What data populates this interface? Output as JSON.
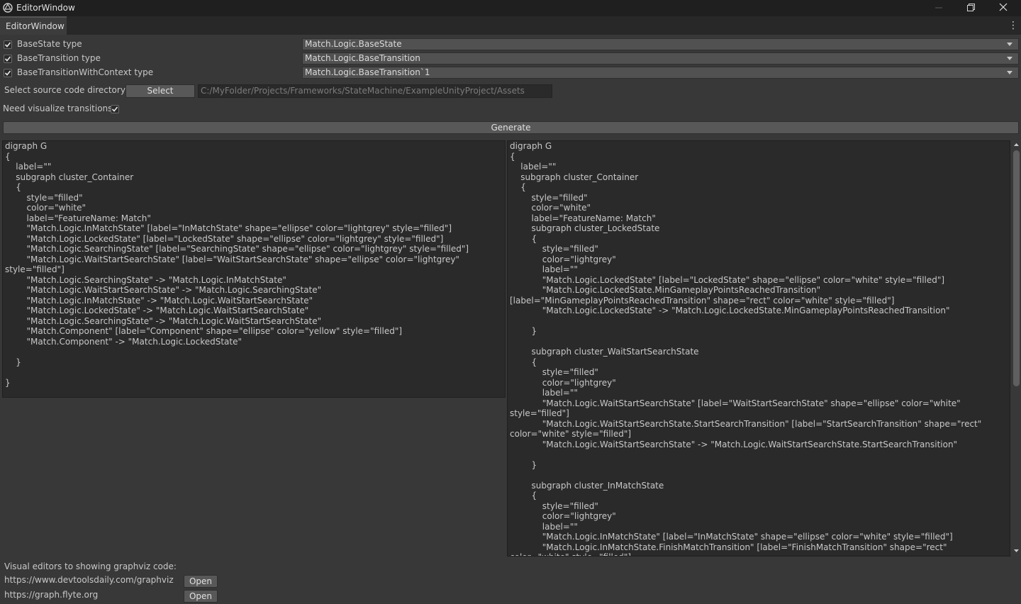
{
  "window": {
    "title": "EditorWindow",
    "minimize_icon": "minimize-icon",
    "maximize_icon": "restore-icon",
    "close_icon": "close-icon"
  },
  "tab": {
    "label": "EditorWindow",
    "menu_icon": "kebab-menu-icon"
  },
  "type_rows": [
    {
      "label": "BaseState type",
      "checked": true,
      "value": "Match.Logic.BaseState"
    },
    {
      "label": "BaseTransition type",
      "checked": true,
      "value": "Match.Logic.BaseTransition"
    },
    {
      "label": "BaseTransitionWithContext type",
      "checked": true,
      "value": "Match.Logic.BaseTransition`1"
    }
  ],
  "source": {
    "label": "Select source code directory",
    "button_label": "Select",
    "path": "C:/MyFolder/Projects/Frameworks/StateMachine/ExampleUnityProject/Assets"
  },
  "visualize": {
    "label": "Need visualize transitions",
    "checked": true
  },
  "generate_label": "Generate",
  "left_code": "digraph G\n{\n\tlabel=\"\"\n\tsubgraph cluster_Container\n\t{\n\t\tstyle=\"filled\"\n\t\tcolor=\"white\"\n\t\tlabel=\"FeatureName: Match\"\n\t\t\"Match.Logic.InMatchState\" [label=\"InMatchState\" shape=\"ellipse\" color=\"lightgrey\" style=\"filled\"]\n\t\t\"Match.Logic.LockedState\" [label=\"LockedState\" shape=\"ellipse\" color=\"lightgrey\" style=\"filled\"]\n\t\t\"Match.Logic.SearchingState\" [label=\"SearchingState\" shape=\"ellipse\" color=\"lightgrey\" style=\"filled\"]\n\t\t\"Match.Logic.WaitStartSearchState\" [label=\"WaitStartSearchState\" shape=\"ellipse\" color=\"lightgrey\"\nstyle=\"filled\"]\n\t\t\"Match.Logic.SearchingState\" -> \"Match.Logic.InMatchState\"\n\t\t\"Match.Logic.WaitStartSearchState\" -> \"Match.Logic.SearchingState\"\n\t\t\"Match.Logic.InMatchState\" -> \"Match.Logic.WaitStartSearchState\"\n\t\t\"Match.Logic.LockedState\" -> \"Match.Logic.WaitStartSearchState\"\n\t\t\"Match.Logic.SearchingState\" -> \"Match.Logic.WaitStartSearchState\"\n\t\t\"Match.Component\" [label=\"Component\" shape=\"ellipse\" color=\"yellow\" style=\"filled\"]\n\t\t\"Match.Component\" -> \"Match.Logic.LockedState\"\n\n\t}\n\n}",
  "right_code": "digraph G\n{\n\tlabel=\"\"\n\tsubgraph cluster_Container\n\t{\n\t\tstyle=\"filled\"\n\t\tcolor=\"white\"\n\t\tlabel=\"FeatureName: Match\"\n\t\tsubgraph cluster_LockedState\n\t\t{\n\t\t\tstyle=\"filled\"\n\t\t\tcolor=\"lightgrey\"\n\t\t\tlabel=\"\"\n\t\t\t\"Match.Logic.LockedState\" [label=\"LockedState\" shape=\"ellipse\" color=\"white\" style=\"filled\"]\n\t\t\t\"Match.Logic.LockedState.MinGameplayPointsReachedTransition\"\n[label=\"MinGameplayPointsReachedTransition\" shape=\"rect\" color=\"white\" style=\"filled\"]\n\t\t\t\"Match.Logic.LockedState\" -> \"Match.Logic.LockedState.MinGameplayPointsReachedTransition\"\n\n\t\t}\n\n\t\tsubgraph cluster_WaitStartSearchState\n\t\t{\n\t\t\tstyle=\"filled\"\n\t\t\tcolor=\"lightgrey\"\n\t\t\tlabel=\"\"\n\t\t\t\"Match.Logic.WaitStartSearchState\" [label=\"WaitStartSearchState\" shape=\"ellipse\" color=\"white\"\nstyle=\"filled\"]\n\t\t\t\"Match.Logic.WaitStartSearchState.StartSearchTransition\" [label=\"StartSearchTransition\" shape=\"rect\"\ncolor=\"white\" style=\"filled\"]\n\t\t\t\"Match.Logic.WaitStartSearchState\" -> \"Match.Logic.WaitStartSearchState.StartSearchTransition\"\n\n\t\t}\n\n\t\tsubgraph cluster_InMatchState\n\t\t{\n\t\t\tstyle=\"filled\"\n\t\t\tcolor=\"lightgrey\"\n\t\t\tlabel=\"\"\n\t\t\t\"Match.Logic.InMatchState\" [label=\"InMatchState\" shape=\"ellipse\" color=\"white\" style=\"filled\"]\n\t\t\t\"Match.Logic.InMatchState.FinishMatchTransition\" [label=\"FinishMatchTransition\" shape=\"rect\"\ncolor=\"white\" style=\"filled\"]",
  "footer": {
    "heading": "Visual editors to showing graphviz code:",
    "links": [
      {
        "url": "https://www.devtoolsdaily.com/graphviz",
        "button_label": "Open"
      },
      {
        "url": "https://graph.flyte.org",
        "button_label": "Open"
      }
    ]
  }
}
